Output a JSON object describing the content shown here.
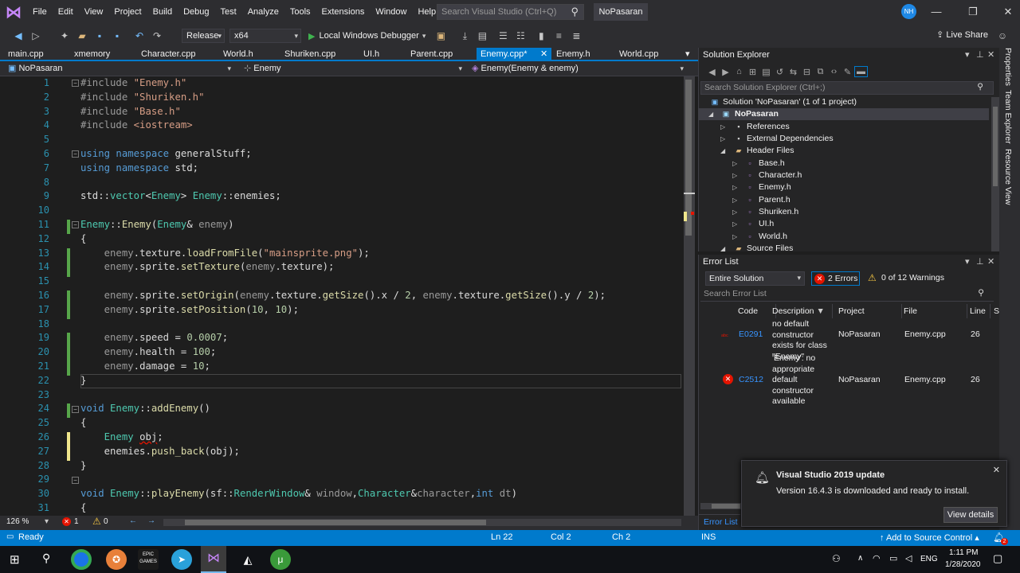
{
  "menu": {
    "items": [
      "File",
      "Edit",
      "View",
      "Project",
      "Build",
      "Debug",
      "Test",
      "Analyze",
      "Tools",
      "Extensions",
      "Window",
      "Help"
    ],
    "search_placeholder": "Search Visual Studio (Ctrl+Q)",
    "solution_name": "NoPasaran",
    "avatar_initials": "NH"
  },
  "toolbar": {
    "config": "Release",
    "platform": "x64",
    "debugger": "Local Windows Debugger",
    "live_share": "Live Share"
  },
  "tabs": [
    "main.cpp",
    "xmemory",
    "Character.cpp",
    "World.h",
    "Shuriken.cpp",
    "UI.h",
    "Parent.cpp",
    "Enemy.cpp*",
    "Enemy.h",
    "World.cpp"
  ],
  "navbar": {
    "project": "NoPasaran",
    "scope": "Enemy",
    "member": "Enemy(Enemy & enemy)"
  },
  "line_numbers": [
    "1",
    "2",
    "3",
    "4",
    "5",
    "6",
    "7",
    "8",
    "9",
    "10",
    "11",
    "12",
    "13",
    "14",
    "15",
    "16",
    "17",
    "18",
    "19",
    "20",
    "21",
    "22",
    "23",
    "24",
    "25",
    "26",
    "27",
    "28",
    "29",
    "30",
    "31"
  ],
  "code": {
    "l1": [
      "#include ",
      "\"Enemy.h\""
    ],
    "l2": [
      "#include ",
      "\"Shuriken.h\""
    ],
    "l3": [
      "#include ",
      "\"Base.h\""
    ],
    "l4": [
      "#include ",
      "<iostream>"
    ],
    "l6": [
      "using",
      " namespace ",
      "generalStuff;"
    ],
    "l7": [
      "using",
      " namespace ",
      "std;"
    ],
    "l9": [
      "std::",
      "vector",
      "<",
      "Enemy",
      "> ",
      "Enemy",
      "::enemies;"
    ],
    "l11": [
      "Enemy",
      "::",
      "Enemy",
      "(",
      "Enemy",
      "& ",
      "enemy",
      ")"
    ],
    "l12": "{",
    "l13": [
      "enemy",
      ".",
      "texture",
      ".",
      "loadFromFile",
      "(",
      "\"mainsprite.png\"",
      ");"
    ],
    "l14": [
      "enemy",
      ".",
      "sprite",
      ".",
      "setTexture",
      "(",
      "enemy",
      ".",
      "texture",
      ");"
    ],
    "l16": [
      "enemy",
      ".",
      "sprite",
      ".",
      "setOrigin",
      "(",
      "enemy",
      ".",
      "texture",
      ".",
      "getSize",
      "().",
      "x",
      " / ",
      "2",
      ", ",
      "enemy",
      ".",
      "texture",
      ".",
      "getSize",
      "().",
      "y",
      " / ",
      "2",
      ");"
    ],
    "l17": [
      "enemy",
      ".",
      "sprite",
      ".",
      "setPosition",
      "(",
      "10",
      ", ",
      "10",
      ");"
    ],
    "l19": [
      "enemy",
      ".",
      "speed",
      " = ",
      "0.0007",
      ";"
    ],
    "l20": [
      "enemy",
      ".",
      "health",
      " = ",
      "100",
      ";"
    ],
    "l21": [
      "enemy",
      ".",
      "damage",
      " = ",
      "10",
      ";"
    ],
    "l22": "}",
    "l24": [
      "void",
      " ",
      "Enemy",
      "::",
      "addEnemy",
      "()"
    ],
    "l25": "{",
    "l26": [
      "Enemy",
      " ",
      "obj",
      ";"
    ],
    "l27": [
      "enemies.",
      "push_back",
      "(obj);"
    ],
    "l28": "}",
    "l30": [
      "void",
      " ",
      "Enemy",
      "::",
      "playEnemy",
      "(",
      "sf",
      "::",
      "RenderWindow",
      "& ",
      "window",
      ",",
      "Character",
      "&",
      "character",
      ",",
      "int",
      " ",
      "dt",
      ")"
    ],
    "l31": "{"
  },
  "editor_status": {
    "zoom": "126 %",
    "errors": "1",
    "warnings": "0"
  },
  "solution_explorer": {
    "title": "Solution Explorer",
    "search_placeholder": "Search Solution Explorer (Ctrl+;)",
    "solution_label": "Solution 'NoPasaran' (1 of 1 project)",
    "project": "NoPasaran",
    "references": "References",
    "external": "External Dependencies",
    "header_files": "Header Files",
    "headers": [
      "Base.h",
      "Character.h",
      "Enemy.h",
      "Parent.h",
      "Shuriken.h",
      "UI.h",
      "World.h"
    ],
    "source_files": "Source Files"
  },
  "error_list": {
    "title": "Error List",
    "scope": "Entire Solution",
    "errors_label": "2 Errors",
    "warnings_label": "0 of 12 Warnings",
    "search_placeholder": "Search Error List",
    "columns": [
      "Code",
      "Description",
      "Project",
      "File",
      "Line",
      "S"
    ],
    "rows": [
      {
        "code": "E0291",
        "description": "no default constructor exists for class \"Enemy\"",
        "project": "NoPasaran",
        "file": "Enemy.cpp",
        "line": "26"
      },
      {
        "code": "C2512",
        "description": "'Enemy': no appropriate default constructor available",
        "project": "NoPasaran",
        "file": "Enemy.cpp",
        "line": "26"
      }
    ],
    "footer_tab": "Error List"
  },
  "side_tabs": [
    "Properties",
    "Team Explorer",
    "Resource View"
  ],
  "toast": {
    "title": "Visual Studio 2019 update",
    "body": "Version 16.4.3 is downloaded and ready to install.",
    "button": "View details"
  },
  "status": {
    "ready": "Ready",
    "ln": "Ln 22",
    "col": "Col 2",
    "ch": "Ch 2",
    "ins": "INS",
    "source_control": "Add to Source Control",
    "badge": "2"
  },
  "taskbar": {
    "lang": "ENG",
    "time": "1:11 PM",
    "date": "1/28/2020",
    "epic": "EPIC GAMES"
  }
}
